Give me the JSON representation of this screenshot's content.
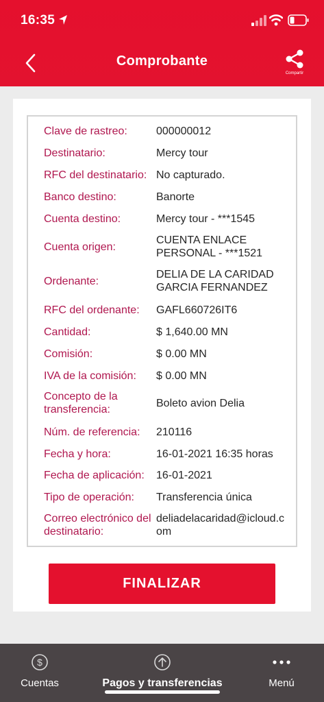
{
  "status_bar": {
    "time": "16:35"
  },
  "header": {
    "title": "Comprobante",
    "share_label": "Compartir"
  },
  "receipt": [
    {
      "label": "Clave de rastreo:",
      "value": "000000012"
    },
    {
      "label": "Destinatario:",
      "value": "Mercy tour"
    },
    {
      "label": "RFC del destinatario:",
      "value": "No capturado."
    },
    {
      "label": "Banco destino:",
      "value": "Banorte"
    },
    {
      "label": "Cuenta destino:",
      "value": "Mercy tour - ***1545"
    },
    {
      "label": "Cuenta origen:",
      "value": "CUENTA ENLACE PERSONAL - ***1521"
    },
    {
      "label": "Ordenante:",
      "value": "DELIA DE LA CARIDAD GARCIA FERNANDEZ"
    },
    {
      "label": "RFC del ordenante:",
      "value": "GAFL660726IT6"
    },
    {
      "label": "Cantidad:",
      "value": "$ 1,640.00 MN"
    },
    {
      "label": "Comisión:",
      "value": "$ 0.00 MN"
    },
    {
      "label": "IVA de la comisión:",
      "value": "$ 0.00 MN"
    },
    {
      "label": "Concepto de la transferencia:",
      "value": "Boleto avion Delia"
    },
    {
      "label": "Núm. de referencia:",
      "value": "210116"
    },
    {
      "label": "Fecha y hora:",
      "value": "16-01-2021 16:35 horas"
    },
    {
      "label": "Fecha de aplicación:",
      "value": "16-01-2021"
    },
    {
      "label": "Tipo de operación:",
      "value": "Transferencia única"
    },
    {
      "label": "Correo electrónico del destinatario:",
      "value": "deliadelacaridad@icloud.com"
    }
  ],
  "actions": {
    "finalize_label": "FINALIZAR"
  },
  "bottom_nav": {
    "accounts": "Cuentas",
    "payments": "Pagos y transferencias",
    "menu": "Menú"
  },
  "colors": {
    "brand_red": "#e4112e",
    "label_color": "#b0174f",
    "nav_bg": "#4a4446"
  }
}
